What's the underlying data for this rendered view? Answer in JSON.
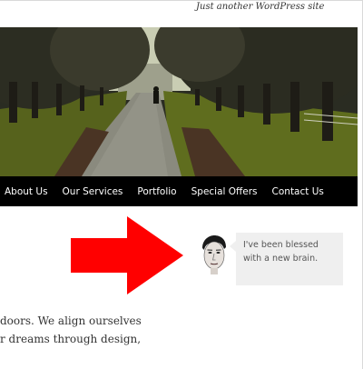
{
  "header": {
    "tagline": "Just another WordPress site"
  },
  "hero": {
    "image_icon": "tree-lined-avenue-photo",
    "colors": {
      "sky": "#cfd3b8",
      "foliage": "#2b2e20",
      "path": "#8c8c80",
      "grass": "#5d6b1f"
    }
  },
  "nav": {
    "items": [
      {
        "label": "About Us"
      },
      {
        "label": "Our Services"
      },
      {
        "label": "Portfolio"
      },
      {
        "label": "Special Offers"
      },
      {
        "label": "Contact Us"
      }
    ]
  },
  "callout": {
    "arrow_color": "#ff0000",
    "avatar_icon": "face-avatar",
    "quote": "I've been blessed with a new brain."
  },
  "content": {
    "line1": "doors. We align ourselves",
    "line2": "r dreams through design,"
  }
}
